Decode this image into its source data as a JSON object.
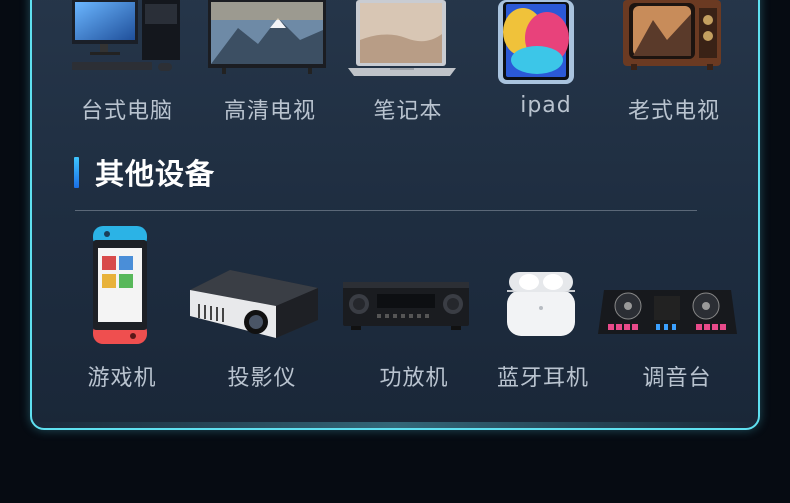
{
  "top_row": [
    {
      "label": "台式电脑",
      "icon": "desktop-pc-icon"
    },
    {
      "label": "高清电视",
      "icon": "hd-tv-icon"
    },
    {
      "label": "笔记本",
      "icon": "laptop-icon"
    },
    {
      "label": "ipad",
      "icon": "tablet-icon"
    },
    {
      "label": "老式电视",
      "icon": "retro-tv-icon"
    }
  ],
  "section": {
    "title": "其他设备"
  },
  "bottom_row": [
    {
      "label": "游戏机",
      "icon": "game-console-icon"
    },
    {
      "label": "投影仪",
      "icon": "projector-icon"
    },
    {
      "label": "功放机",
      "icon": "amplifier-icon"
    },
    {
      "label": "蓝牙耳机",
      "icon": "earbuds-icon"
    },
    {
      "label": "调音台",
      "icon": "dj-mixer-icon"
    }
  ],
  "colors": {
    "accent": "#5fe0f0",
    "title_bar": "#2f9bff",
    "label": "#b9c3cf",
    "panel": "#22324a"
  }
}
